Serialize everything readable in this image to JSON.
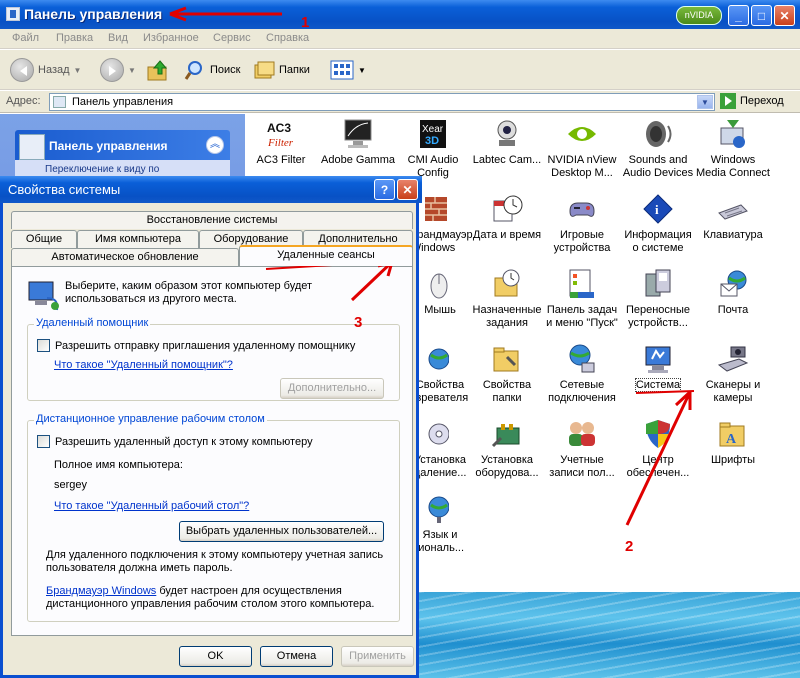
{
  "window": {
    "title": "Панель управления"
  },
  "menu": [
    "Файл",
    "Правка",
    "Вид",
    "Избранное",
    "Сервис",
    "Справка"
  ],
  "toolbar": {
    "back": "Назад",
    "search": "Поиск",
    "folders": "Папки"
  },
  "address": {
    "label": "Адрес:",
    "value": "Панель управления",
    "go": "Переход"
  },
  "sidebar": {
    "title": "Панель управления",
    "link": "Переключение к виду по"
  },
  "icons": [
    {
      "label": "AC3 Filter"
    },
    {
      "label": "Adobe Gamma"
    },
    {
      "label": "CMI Audio Config"
    },
    {
      "label": "Labtec Cam..."
    },
    {
      "label": "NVIDIA nView Desktop M..."
    },
    {
      "label": "Sounds and Audio Devices"
    },
    {
      "label": "Windows Media Connect"
    },
    {
      "label": "Брандмауэр Windows"
    },
    {
      "label": "Дата и время"
    },
    {
      "label": "Игровые устройства"
    },
    {
      "label": "Информация о системе"
    },
    {
      "label": "Клавиатура"
    },
    {
      "label": "Мышь"
    },
    {
      "label": "Назначенные задания"
    },
    {
      "label": "Панель задач и меню \"Пуск\""
    },
    {
      "label": "Переносные устройств..."
    },
    {
      "label": "Почта"
    },
    {
      "label": "Свойства обозревателя"
    },
    {
      "label": "Свойства папки"
    },
    {
      "label": "Сетевые подключения"
    },
    {
      "label": "Система"
    },
    {
      "label": "Сканеры и камеры"
    },
    {
      "label": "Установка и удаление..."
    },
    {
      "label": "Установка оборудова..."
    },
    {
      "label": "Учетные записи пол..."
    },
    {
      "label": "Центр обеспечен..."
    },
    {
      "label": "Шрифты"
    },
    {
      "label": "Язык и региональ..."
    }
  ],
  "dialog": {
    "title": "Свойства системы",
    "tabs": {
      "restore": "Восстановление системы",
      "general": "Общие",
      "computer_name": "Имя компьютера",
      "hardware": "Оборудование",
      "advanced": "Дополнительно",
      "auto_update": "Автоматическое обновление",
      "remote": "Удаленные сеансы"
    },
    "intro": "Выберите, каким образом этот компьютер будет использоваться из другого места.",
    "assistance": {
      "group": "Удаленный помощник",
      "checkbox": "Разрешить отправку приглашения удаленному помощнику",
      "link": "Что такое \"Удаленный помощник\"?",
      "advanced_btn": "Дополнительно..."
    },
    "desktop": {
      "group": "Дистанционное управление рабочим столом",
      "checkbox": "Разрешить удаленный доступ к этому компьютеру",
      "full_name_label": "Полное имя компьютера:",
      "computer_name": "sergey",
      "link": "Что такое \"Удаленный рабочий стол\"?",
      "select_users_btn": "Выбрать удаленных пользователей...",
      "note": "Для удаленного подключения к этому компьютеру учетная запись пользователя должна иметь пароль.",
      "firewall_link": "Брандмауэр Windows",
      "firewall_text": "будет настроен для осуществления дистанционного управления рабочим столом этого компьютера."
    },
    "buttons": {
      "ok": "OK",
      "cancel": "Отмена",
      "apply": "Применить"
    }
  },
  "annotations": {
    "n1": "1",
    "n2": "2",
    "n3": "3"
  },
  "colors": {
    "titlebar": "#0851c5",
    "annotation": "#e00000",
    "link": "#0033cc",
    "group_label": "#0046d5"
  }
}
